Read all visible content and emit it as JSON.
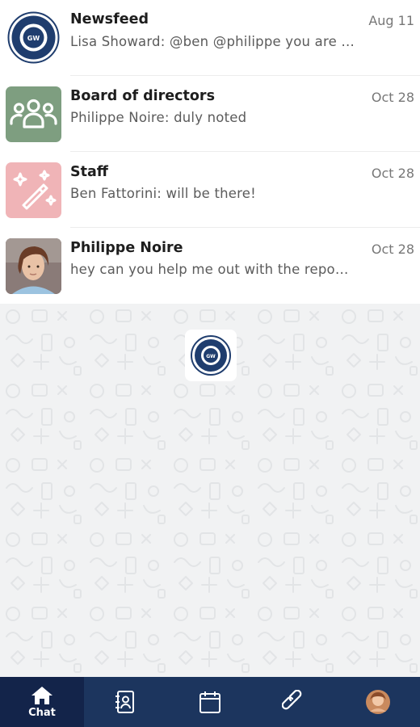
{
  "chats": [
    {
      "name": "Newsfeed",
      "preview": "Lisa Showard: @ben @philippe you are …",
      "date": "Aug 11",
      "avatar": "union-logo"
    },
    {
      "name": "Board of directors",
      "preview": "Philippe Noire: duly noted",
      "date": "Oct 28",
      "avatar": "group-icon"
    },
    {
      "name": "Staff",
      "preview": "Ben Fattorini: will be there!",
      "date": "Oct 28",
      "avatar": "magic-wand-icon"
    },
    {
      "name": "Philippe Noire",
      "preview": "hey can you help me out with the repo…",
      "date": "Oct 28",
      "avatar": "user-photo"
    }
  ],
  "colors": {
    "nav_background": "#1c355e",
    "nav_active": "#13244a",
    "group_avatar": "#7e9e80",
    "staff_avatar": "#f0b4b7",
    "empty_background": "#f1f2f3"
  },
  "bottom_nav": [
    {
      "label": "Chat",
      "icon": "home-icon",
      "active": true
    },
    {
      "label": "",
      "icon": "contacts-icon",
      "active": false
    },
    {
      "label": "",
      "icon": "calendar-icon",
      "active": false
    },
    {
      "label": "",
      "icon": "link-icon",
      "active": false
    },
    {
      "label": "",
      "icon": "profile-avatar",
      "active": false
    }
  ]
}
